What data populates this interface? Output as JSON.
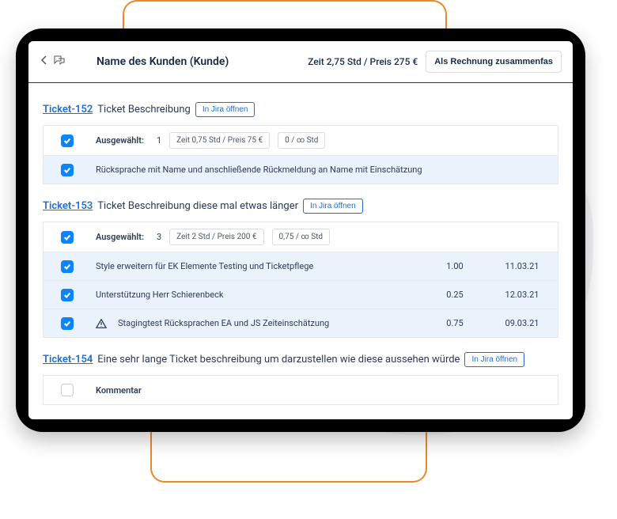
{
  "header": {
    "title": "Name des Kunden (Kunde)",
    "summary": "Zeit 2,75 Std / Preis 275 €",
    "invoice_btn": "Als Rechnung zusammenfas"
  },
  "jira_btn_label": "In Jira öffnen",
  "selected_label": "Ausgewählt:",
  "comment_label": "Kommentar",
  "tickets": [
    {
      "id": "Ticket-152",
      "desc": "Ticket Beschreibung",
      "sel_count": "1",
      "pill_time": "Zeit 0,75 Std / Preis 75 €",
      "pill_est": "0 / ∞ Std",
      "rows": [
        {
          "text": "Rücksprache mit Name und anschließende Rückmeldung an Name mit Einschätzung",
          "hours": "",
          "date": "",
          "warn": false
        }
      ]
    },
    {
      "id": "Ticket-153",
      "desc": "Ticket Beschreibung diese mal etwas länger",
      "sel_count": "3",
      "pill_time": "Zeit 2 Std / Preis 200 €",
      "pill_est": "0,75 / ∞ Std",
      "rows": [
        {
          "text": "Style erweitern für EK Elemente Testing und Ticketpflege",
          "hours": "1.00",
          "date": "11.03.21",
          "warn": false
        },
        {
          "text": "Unterstützung Herr Schierenbeck",
          "hours": "0.25",
          "date": "12.03.21",
          "warn": false
        },
        {
          "text": "Stagingtest Rücksprachen EA und JS Zeiteinschätzung",
          "hours": "0.75",
          "date": "09.03.21",
          "warn": true
        }
      ]
    },
    {
      "id": "Ticket-154",
      "desc": "Eine sehr lange Ticket beschreibung um darzustellen wie diese aussehen würde",
      "sel_count": "",
      "pill_time": "",
      "pill_est": "",
      "rows": []
    }
  ]
}
